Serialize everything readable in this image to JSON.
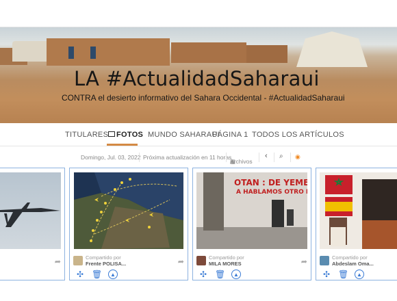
{
  "hero": {
    "title": "LA #ActualidadSaharaui",
    "subtitle": "CONTRA el desierto informativo del Sahara Occidental - #ActualidadSaharaui"
  },
  "nav": {
    "items": [
      {
        "label": "TITULARES"
      },
      {
        "label": "FOTOS",
        "icon": "image-icon",
        "active": true
      },
      {
        "label": "MUNDO SAHARAUI"
      },
      {
        "label": "PÁGINA 1"
      },
      {
        "label": "TODOS LOS ARTÍCULOS"
      }
    ]
  },
  "toolbar": {
    "date": "Domingo, Jul. 03, 2022",
    "next_update": "Próxima actualización en 11 horas",
    "archive": "Archivos"
  },
  "cards": [
    {
      "shared_label": "",
      "author": "",
      "image": "drone aircraft in sky"
    },
    {
      "shared_label": "Compartido por",
      "author": "Frente POLISA...",
      "image": "map with aircraft routes"
    },
    {
      "shared_label": "Compartido por",
      "author": "MILA MORES",
      "image": "graffiti wall OTAN DE YEMEN"
    },
    {
      "shared_label": "Compartido por",
      "author": "Abdeslam Oma...",
      "image": "flags and portraits"
    }
  ],
  "graffiti": {
    "line1": "OTAN : DE YEMEN",
    "line2": "A HABLAMOS OTRO DIA"
  },
  "colors": {
    "accent": "#d48a45",
    "card_border": "#8cb2e0",
    "action_blue": "#3a7bd5",
    "rss": "#f08a24"
  }
}
